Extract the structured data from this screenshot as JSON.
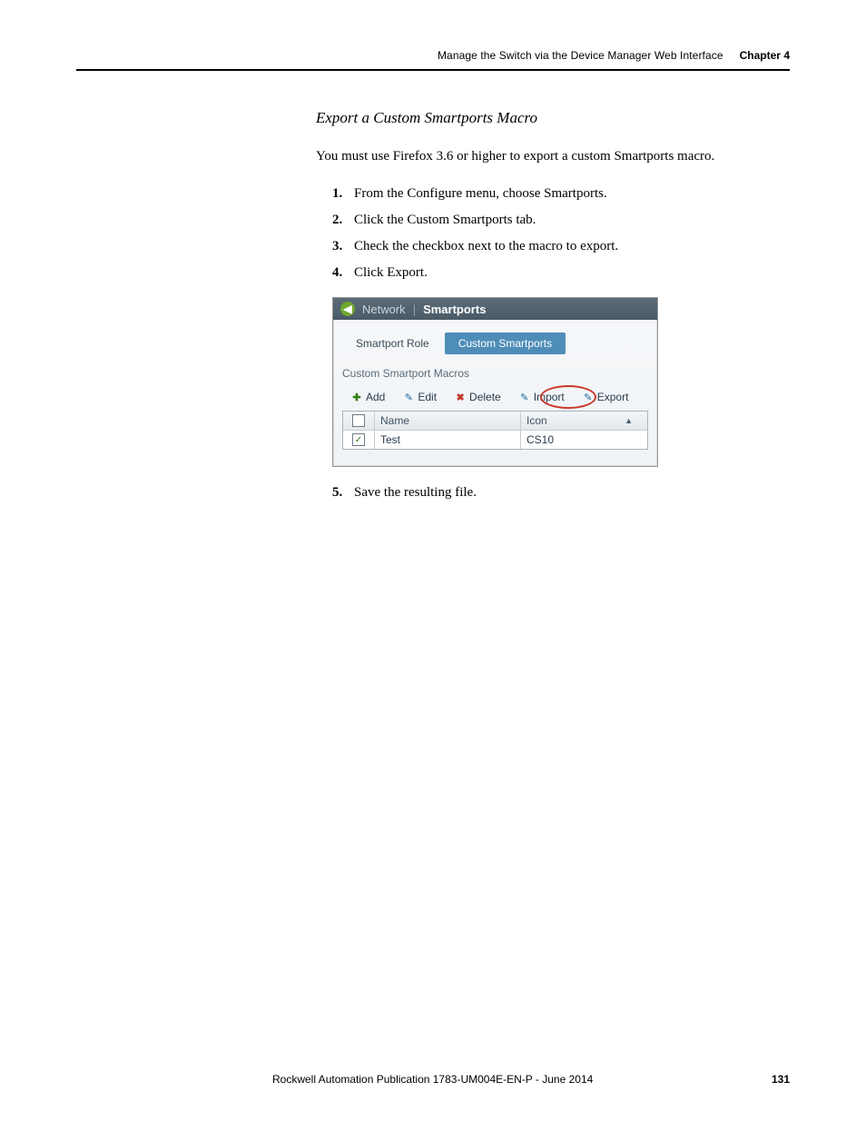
{
  "header": {
    "title": "Manage the Switch via the Device Manager Web Interface",
    "chapter": "Chapter 4"
  },
  "section_heading": "Export a Custom Smartports Macro",
  "intro": "You must use Firefox 3.6 or higher to export a custom Smartports macro.",
  "steps": [
    "From the Configure menu, choose Smartports.",
    "Click the Custom Smartports tab.",
    "Check the checkbox next to the macro to export.",
    "Click Export."
  ],
  "step5": "Save the resulting file.",
  "shot": {
    "breadcrumb_parent": "Network",
    "breadcrumb_sep": "|",
    "breadcrumb_current": "Smartports",
    "tabs": {
      "inactive": "Smartport Role",
      "active": "Custom Smartports"
    },
    "section_label": "Custom Smartport Macros",
    "toolbar": {
      "add": "Add",
      "edit": "Edit",
      "delete": "Delete",
      "import": "Import",
      "export": "Export"
    },
    "grid": {
      "headers": {
        "name": "Name",
        "icon": "Icon"
      },
      "row": {
        "name": "Test",
        "icon": "CS10"
      }
    }
  },
  "footer": {
    "publication": "Rockwell Automation Publication 1783-UM004E-EN-P - June 2014",
    "page": "131"
  }
}
